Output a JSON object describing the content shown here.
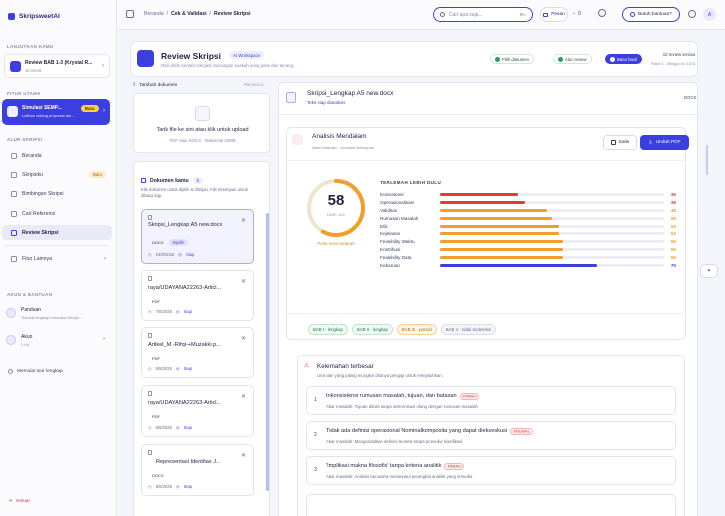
{
  "app": {
    "name": "SkripsweetAI"
  },
  "sidebar": {
    "sec_main": "LANJUTKAN KAMU",
    "continue_title": "Review BAB 1-3 (Krystal R...",
    "continue_sub": "15 menit",
    "sec_features": "FITUR UTAMA",
    "sim_title": "Simulasi SEMP...",
    "sim_badge": "Baru",
    "sim_sub": "Latihan sidang proposal ala ...",
    "sec_flow": "ALUR SKRIPSI",
    "items": [
      {
        "label": "Beranda",
        "badge": ""
      },
      {
        "label": "Skripsiku",
        "badge": "Baru"
      },
      {
        "label": "Bimbingan Skripsi",
        "badge": ""
      },
      {
        "label": "Cari Referensi",
        "badge": ""
      },
      {
        "label": "Review Skripsi",
        "badge": ""
      },
      {
        "label": "Fitur Lainnya",
        "badge": ""
      }
    ],
    "sec_account": "AKUN & BANTUAN",
    "guide_title": "Panduan",
    "guide_sub": "Tutorial lengkap memakai Skrips...",
    "account_title": "Akun",
    "account_sub": "1 Ko",
    "tour": "Memulai tour lengkap",
    "logout": "Keluar"
  },
  "topbar": {
    "crumb1": "Beranda",
    "crumb2": "Cek & Validasi",
    "crumb3": "Review Skripsi",
    "search_placeholder": "Cari apa saja...",
    "search_kbd": "⌘K",
    "btn_pesan": "Pesan",
    "count": "0",
    "help": "Butuh bantuan?",
    "avatar": "A"
  },
  "page": {
    "title": "Review Skripsi",
    "badge": "AI Workspace",
    "subtitle": "Dari draft mentah menjadi rancangan naskah yang jelas dan tenang.",
    "step1": "Pilih dokumen",
    "step2": "Atur review",
    "step3": "Baca hasil",
    "quota_title": "10 review tersisa",
    "quota_sub": "Paket 1 - Minggu ini: 1/2/3"
  },
  "upload": {
    "label": "Tambah dokumen",
    "hint": "PDF/DOCX",
    "drop_title": "Tarik file ke sini atau klik untuk upload",
    "drop_sub": "PDF atau DOCX · Maksimal 20MB"
  },
  "docs": {
    "title": "Dokumen kamu",
    "count": "5",
    "desc": "Klik dokumen untuk dipilih & ditinjau. File tersimpan untuk dibaca lagi.",
    "items": [
      {
        "name": "Skripsi_Lengkap A5 new.docx",
        "fmt": "DOCX",
        "tag": "Dipilih",
        "date": "15/8/2025",
        "status": "Siap"
      },
      {
        "name": "raya/UDAYANA22263-Articl...",
        "fmt": "PDF",
        "tag": "",
        "date": "7/8/2025",
        "status": "Siap"
      },
      {
        "name": "Artikel_M.-Rifqi-+Muzakki.p...",
        "fmt": "PDF",
        "tag": "",
        "date": "5/8/2025",
        "status": "Siap"
      },
      {
        "name": "raya/UDAYANA22263-Articl...",
        "fmt": "PDF",
        "tag": "",
        "date": "6/8/2025",
        "status": "Siap"
      },
      {
        "name": "Representasi Identitas J...",
        "fmt": "DOCX",
        "tag": "",
        "date": "5/8/2025",
        "status": "Siap"
      }
    ]
  },
  "review": {
    "file": "Skripsi_Lengkap A5 new.docx",
    "file_sub": "Teks siap dianalisis",
    "fmt": "DOCX",
    "analysis_title": "Analisis Mendalam",
    "analysis_sub": "Hasil evaluasi - otomatis tersimpan",
    "copy": "Salin",
    "download": "Unduh PDF",
    "score": "58",
    "score_label": "DARI 100",
    "score_note": "Perlu revisi tertarah",
    "section_title": "TERLEMAH LEBIH DULU",
    "chapters": [
      "BAB I · lengkap",
      "BAB II · lengkap",
      "BAB III · parsial",
      "BAB V · tidak terdeteksi"
    ]
  },
  "chart_data": {
    "type": "bar",
    "title": "TERLEMAH LEBIH DULU",
    "categories": [
      "Konsistensi",
      "Operasionalisasi",
      "Validitas",
      "Rumusan Masalah",
      "Etik",
      "Kejelasan",
      "Feasibility Waktu",
      "Kontribusi",
      "Feasibility Data",
      "Kebaruan"
    ],
    "values": [
      35,
      38,
      48,
      50,
      53,
      53,
      55,
      55,
      55,
      70
    ],
    "colors": [
      "#e03b3b",
      "#e03b3b",
      "#ef9f2a",
      "#ef9f2a",
      "#ef9f2a",
      "#ef9f2a",
      "#ef9f2a",
      "#ef9f2a",
      "#ef9f2a",
      "#3b3fe0"
    ],
    "ylim": [
      0,
      100
    ]
  },
  "weaknesses": {
    "title": "Kelemahan terbesar",
    "sub": "Urut dari yang paling mungkin ditanya penguji untuk menjatuhkan.",
    "items": [
      {
        "n": "1",
        "title": "Inkonsistensi rumusan masalah, tujuan, dan batasan",
        "sev": "PARAH",
        "desc": "Akar masalah: Tujuan ditulis tanpa sinkronisasi ulang dengan rumusan masalah"
      },
      {
        "n": "2",
        "title": "Tidak ada definisi operasional Nominalkomposita yang dapat diekseskusi",
        "sev": "KRUSIAL",
        "desc": "Akar masalah: Mengandalkan definisi teoretis tanpa prosedur klasifikasi"
      },
      {
        "n": "3",
        "title": "'Implikasi makna filosofis' tanpa kriteria analitik",
        "sev": "PARAH",
        "desc": "Akar masalah: Analisis berusaha melampaui perangkat analitik yang tersedia"
      }
    ]
  }
}
